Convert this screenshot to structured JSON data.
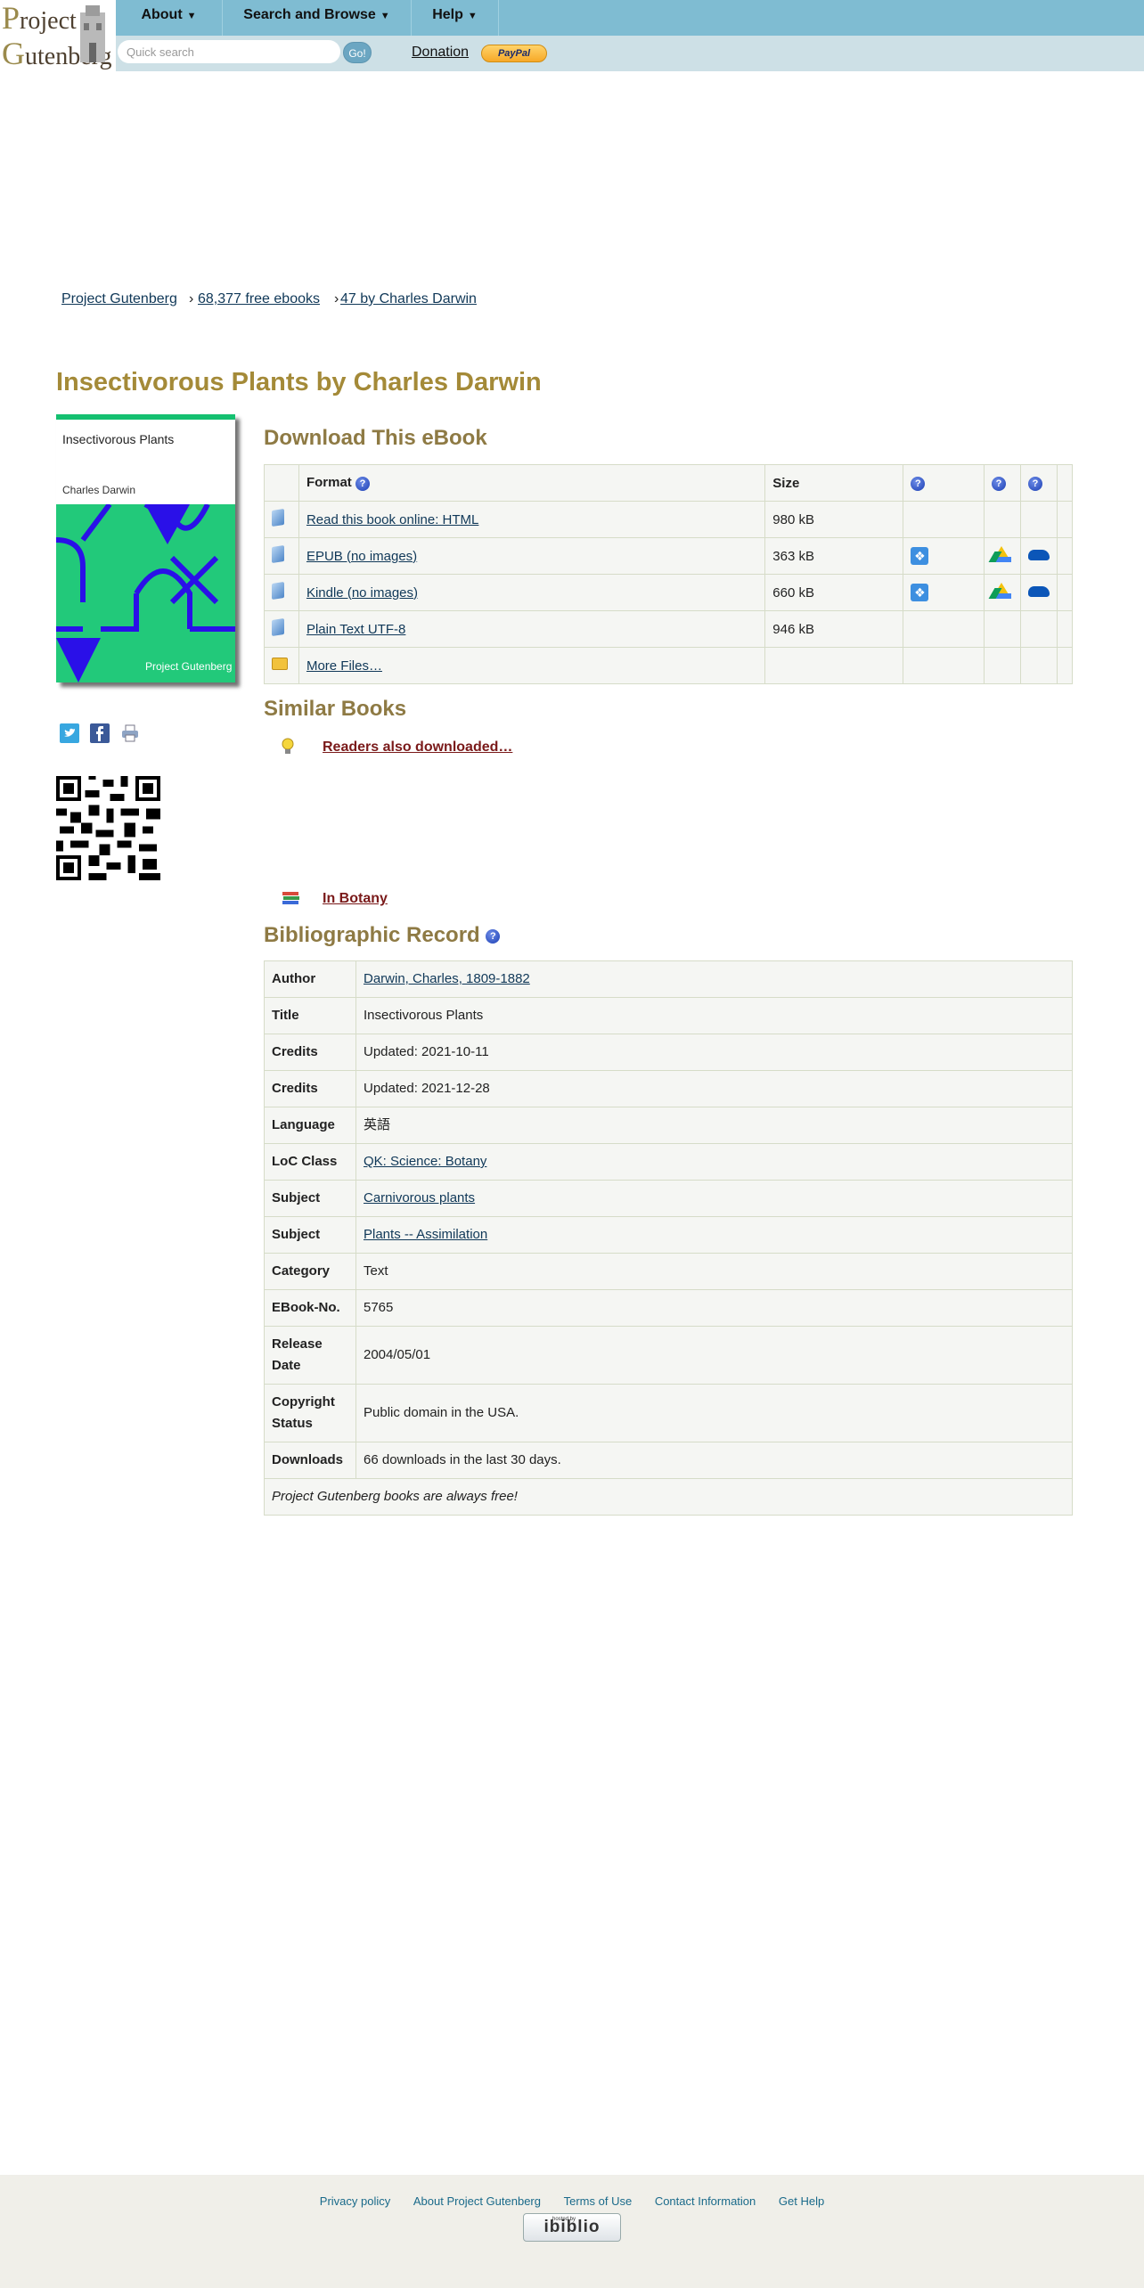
{
  "logo": {
    "line1_cap": "P",
    "line1_rest": "roject",
    "line2_cap": "G",
    "line2_rest": "utenberg"
  },
  "nav": {
    "items": [
      {
        "label": "About"
      },
      {
        "label": "Search and Browse"
      },
      {
        "label": "Help"
      }
    ]
  },
  "search": {
    "placeholder": "Quick search",
    "go_label": "Go!"
  },
  "donation": {
    "label": "Donation",
    "paypal": "PayPal"
  },
  "breadcrumb": [
    "Project Gutenberg",
    "68,377 free ebooks",
    "47 by Charles Darwin"
  ],
  "page_title": "Insectivorous Plants by Charles Darwin",
  "cover": {
    "title": "Insectivorous Plants",
    "author": "Charles Darwin",
    "publisher": "Project Gutenberg"
  },
  "download": {
    "heading": "Download This eBook",
    "headers": {
      "format": "Format",
      "size": "Size"
    },
    "rows": [
      {
        "format": "Read this book online: HTML",
        "size": "980 kB"
      },
      {
        "format": "EPUB (no images)",
        "size": "363 kB"
      },
      {
        "format": "Kindle (no images)",
        "size": "660 kB"
      },
      {
        "format": "Plain Text UTF-8",
        "size": "946 kB"
      },
      {
        "format": "More Files…",
        "size": ""
      }
    ]
  },
  "similar": {
    "heading": "Similar Books",
    "readers_also": "Readers also downloaded…",
    "in_botany": "In Botany"
  },
  "bib": {
    "heading": "Bibliographic Record",
    "rows": [
      {
        "label": "Author",
        "value": "Darwin, Charles, 1809-1882"
      },
      {
        "label": "Title",
        "value": "Insectivorous Plants"
      },
      {
        "label": "Credits",
        "value": "Updated: 2021-10-11"
      },
      {
        "label": "Credits",
        "value": "Updated: 2021-12-28"
      },
      {
        "label": "Language",
        "value": "英語"
      },
      {
        "label": "LoC Class",
        "value": "QK: Science: Botany"
      },
      {
        "label": "Subject",
        "value": "Carnivorous plants"
      },
      {
        "label": "Subject",
        "value": "Plants -- Assimilation"
      },
      {
        "label": "Category",
        "value": "Text"
      },
      {
        "label": "EBook-No.",
        "value": "5765"
      },
      {
        "label": "Release Date",
        "value": "2004/05/01"
      },
      {
        "label": "Copyright Status",
        "value": "Public domain in the USA."
      },
      {
        "label": "Downloads",
        "value": "66 downloads in the last 30 days."
      }
    ],
    "note": "Project Gutenberg books are always free!"
  },
  "footer": {
    "links": [
      "Privacy policy",
      "About Project Gutenberg",
      "Terms of Use",
      "Contact Information",
      "Get Help"
    ],
    "hosted_by": "hosted by",
    "ibiblio": "ibiblio"
  },
  "colors": {
    "navbar": "#7fbcd2",
    "searchbar": "#cde0e6",
    "title": "#a48a38",
    "heading": "#8e7a44",
    "cover_green": "#14c070",
    "cover_art_bg": "#22c97a",
    "cover_art_lines": "#2a10e8",
    "link": "#103858",
    "similar_link": "#7a1a1a"
  }
}
